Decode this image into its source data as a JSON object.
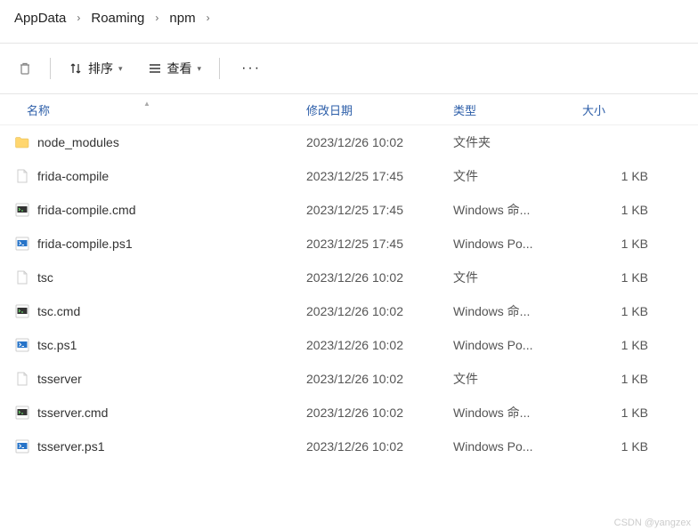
{
  "breadcrumb": [
    "AppData",
    "Roaming",
    "npm"
  ],
  "toolbar": {
    "sort_label": "排序",
    "view_label": "查看"
  },
  "columns": {
    "name": "名称",
    "date": "修改日期",
    "type": "类型",
    "size": "大小"
  },
  "files": [
    {
      "icon": "folder",
      "name": "node_modules",
      "date": "2023/12/26 10:02",
      "type": "文件夹",
      "size": ""
    },
    {
      "icon": "file",
      "name": "frida-compile",
      "date": "2023/12/25 17:45",
      "type": "文件",
      "size": "1 KB"
    },
    {
      "icon": "cmd",
      "name": "frida-compile.cmd",
      "date": "2023/12/25 17:45",
      "type": "Windows 命...",
      "size": "1 KB"
    },
    {
      "icon": "ps1",
      "name": "frida-compile.ps1",
      "date": "2023/12/25 17:45",
      "type": "Windows Po...",
      "size": "1 KB"
    },
    {
      "icon": "file",
      "name": "tsc",
      "date": "2023/12/26 10:02",
      "type": "文件",
      "size": "1 KB"
    },
    {
      "icon": "cmd",
      "name": "tsc.cmd",
      "date": "2023/12/26 10:02",
      "type": "Windows 命...",
      "size": "1 KB"
    },
    {
      "icon": "ps1",
      "name": "tsc.ps1",
      "date": "2023/12/26 10:02",
      "type": "Windows Po...",
      "size": "1 KB"
    },
    {
      "icon": "file",
      "name": "tsserver",
      "date": "2023/12/26 10:02",
      "type": "文件",
      "size": "1 KB"
    },
    {
      "icon": "cmd",
      "name": "tsserver.cmd",
      "date": "2023/12/26 10:02",
      "type": "Windows 命...",
      "size": "1 KB"
    },
    {
      "icon": "ps1",
      "name": "tsserver.ps1",
      "date": "2023/12/26 10:02",
      "type": "Windows Po...",
      "size": "1 KB"
    }
  ],
  "watermark": "CSDN @yangzex"
}
